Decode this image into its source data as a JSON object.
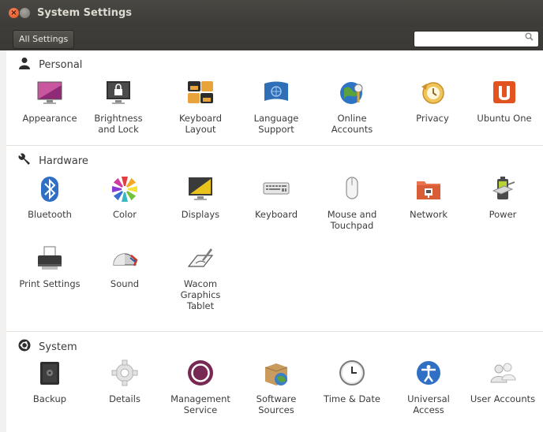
{
  "window": {
    "title": "System Settings"
  },
  "toolbar": {
    "all_settings_label": "All Settings",
    "search_placeholder": ""
  },
  "sections": {
    "personal": {
      "label": "Personal",
      "items": [
        "Appearance",
        "Brightness\nand Lock",
        "Keyboard\nLayout",
        "Language\nSupport",
        "Online\nAccounts",
        "Privacy",
        "Ubuntu One"
      ]
    },
    "hardware": {
      "label": "Hardware",
      "items": [
        "Bluetooth",
        "Color",
        "Displays",
        "Keyboard",
        "Mouse and\nTouchpad",
        "Network",
        "Power",
        "Print Settings",
        "Sound",
        "Wacom\nGraphics\nTablet"
      ]
    },
    "system": {
      "label": "System",
      "items": [
        "Backup",
        "Details",
        "Management\nService",
        "Software\nSources",
        "Time & Date",
        "Universal\nAccess",
        "User Accounts"
      ]
    }
  },
  "colors": {
    "titlebar": "#3c3b37",
    "close_button": "#e2531f",
    "content_bg": "#ffffff",
    "window_bg": "#f2f1f0"
  }
}
